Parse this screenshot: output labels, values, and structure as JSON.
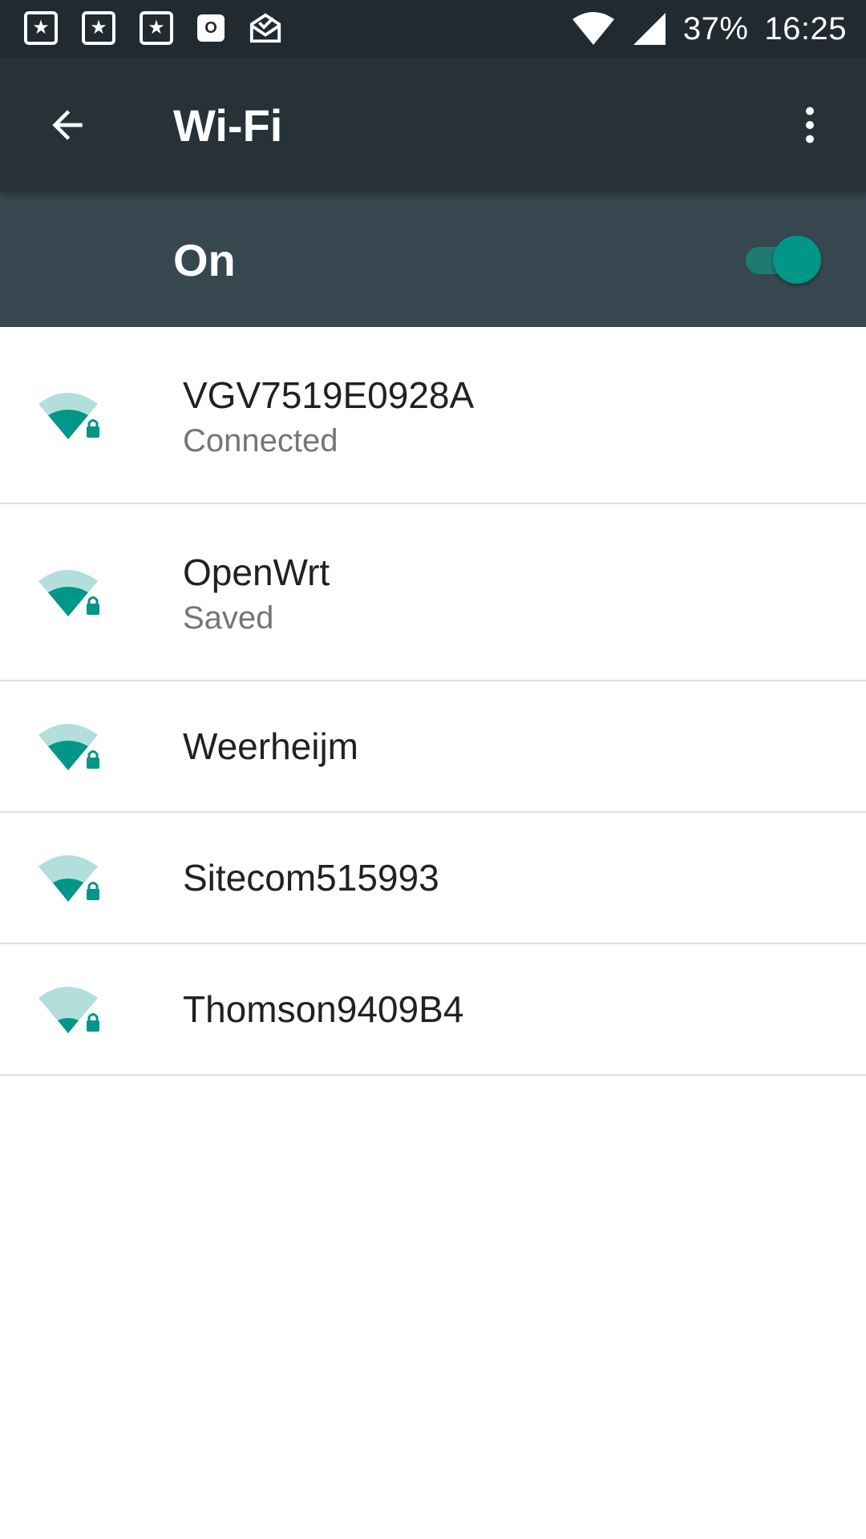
{
  "status_bar": {
    "notifications": [
      {
        "icon": "star-note-icon"
      },
      {
        "icon": "star-note-icon"
      },
      {
        "icon": "star-note-icon"
      },
      {
        "icon": "outlook-icon",
        "glyph": "O"
      },
      {
        "icon": "mail-icon"
      }
    ],
    "battery_text": "37%",
    "time": "16:25"
  },
  "toolbar": {
    "title": "Wi-Fi",
    "back_icon": "back-arrow-icon",
    "overflow_icon": "more-vert-icon"
  },
  "master_switch": {
    "label": "On",
    "state": true,
    "accent": "#009688"
  },
  "networks": [
    {
      "name": "VGV7519E0928A",
      "status": "Connected",
      "secured": true
    },
    {
      "name": "OpenWrt",
      "status": "Saved",
      "secured": true
    },
    {
      "name": "Weerheijm",
      "status": "",
      "secured": true
    },
    {
      "name": "Sitecom515993",
      "status": "",
      "secured": true
    },
    {
      "name": "Thomson9409B4",
      "status": "",
      "secured": true
    }
  ],
  "colors": {
    "status_bar": "#212a30",
    "toolbar": "#263238",
    "switch_bar": "#37474f",
    "wifi_strong": "#009688",
    "wifi_weak": "#b2dfdb"
  }
}
